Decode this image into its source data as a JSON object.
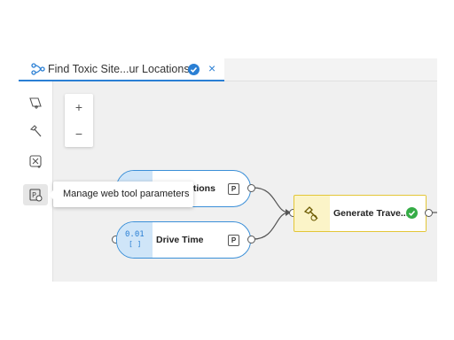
{
  "tab": {
    "title": "Find Toxic Site...ur Locations",
    "close_label": "×",
    "icon": "model-icon",
    "status_icon": "check-circle-icon"
  },
  "toolbar": {
    "items": [
      {
        "name": "add-data-icon"
      },
      {
        "name": "tools-icon"
      },
      {
        "name": "variable-icon"
      },
      {
        "name": "web-tool-parameters-icon",
        "active": true
      }
    ]
  },
  "zoom": {
    "in_label": "+",
    "out_label": "−"
  },
  "nodes": {
    "locations": {
      "label": "ations",
      "param_badge": "P"
    },
    "drive_time": {
      "label": "Drive Time",
      "param_badge": "P",
      "icon_text": "0.01"
    },
    "generate": {
      "label": "Generate Trave...",
      "status_icon": "check-circle-icon"
    }
  },
  "tooltip": {
    "text": "Manage web tool parameters"
  },
  "colors": {
    "accent": "#2a7fd4",
    "success": "#35ac46",
    "tool_border": "#e3c637",
    "variable_fill": "#cfe5f8"
  }
}
